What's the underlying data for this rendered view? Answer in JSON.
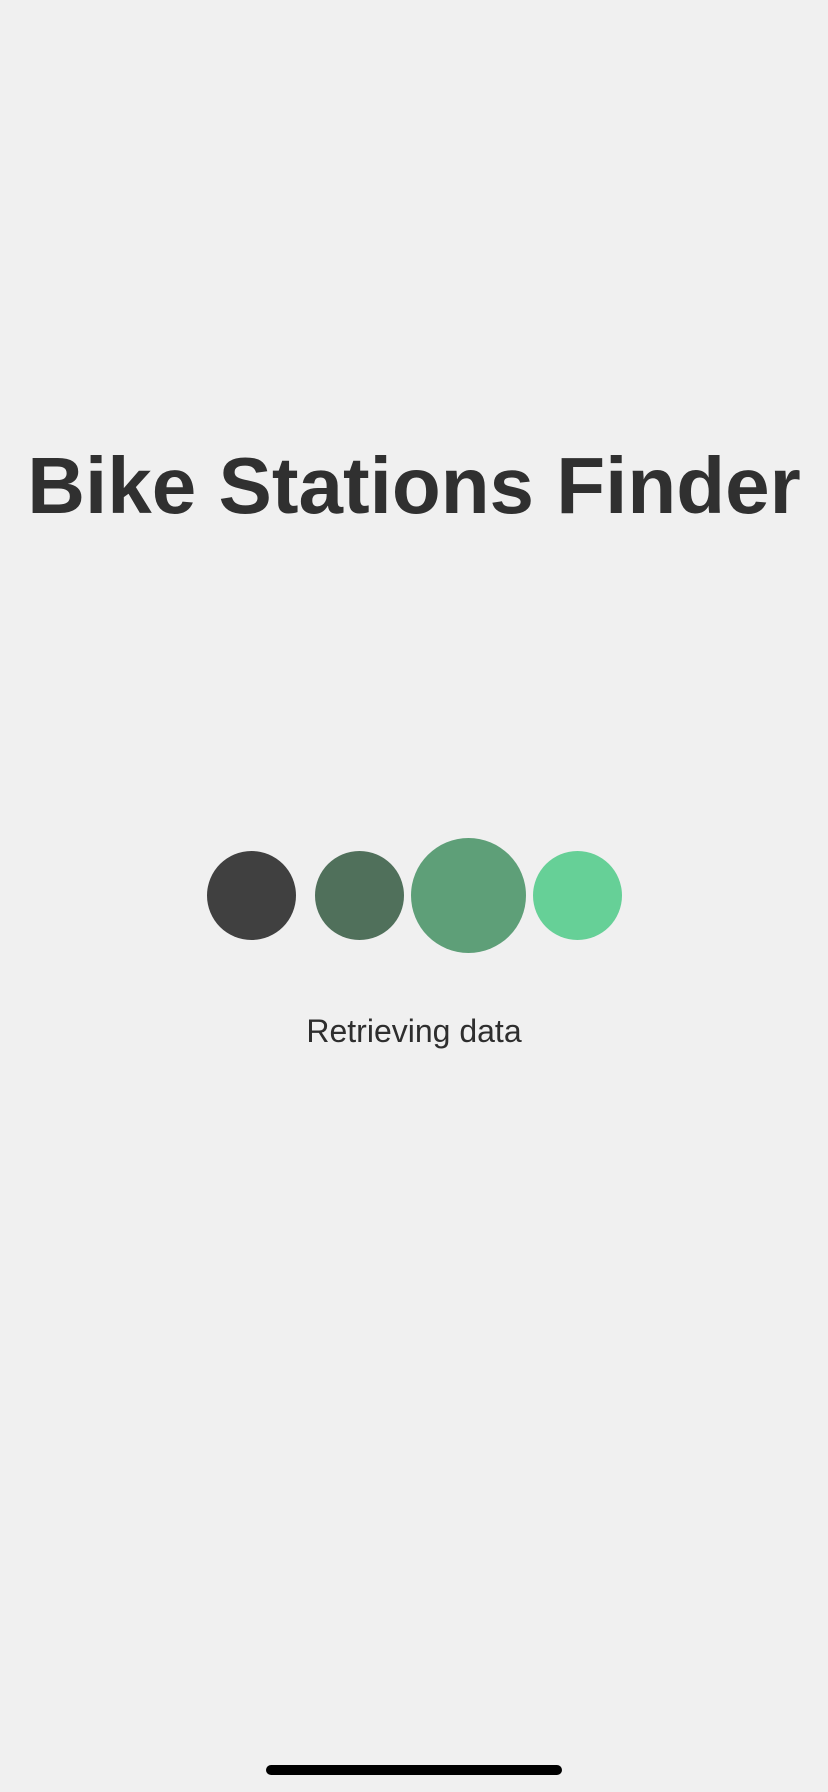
{
  "app": {
    "title": "Bike Stations Finder"
  },
  "loading": {
    "status_text": "Retrieving data",
    "dots": [
      {
        "color": "#404040"
      },
      {
        "color": "#50705b"
      },
      {
        "color": "#5e9f78"
      },
      {
        "color": "#66d097"
      }
    ]
  },
  "colors": {
    "background": "#f0f0f0",
    "title_text": "#303030",
    "home_indicator": "#000000"
  }
}
